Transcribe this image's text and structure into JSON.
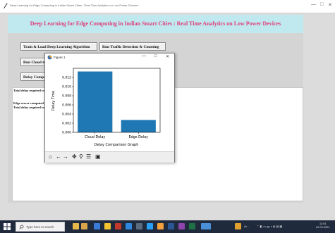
{
  "window": {
    "title": "Deep Learning for Edge Computing in Indian Smart Cities : Real Time Analytics on Low Power Devices",
    "controls": [
      "—",
      "□",
      "✕"
    ]
  },
  "header": {
    "title": "Deep Learning for Edge Computing in Indian Smart Cities : Real Time Analytics on Low Power Devices",
    "title_color": "#e0407a",
    "background": "#bfe8ef"
  },
  "buttons": {
    "train": "Train & Load Deep Learning Algorithm",
    "traffic": "Run Traffic Detection & Counting",
    "cloud": "Run Cloud to E",
    "delay": "Delay Compar"
  },
  "output": {
    "line1": "Total delay required to",
    "line2": "Edge server computed",
    "line3": "Total delay required to"
  },
  "figure": {
    "title": "Figure 1",
    "controls": [
      "—",
      "□",
      "✕"
    ],
    "toolbar": [
      "home-icon",
      "back-icon",
      "forward-icon",
      "pan-icon",
      "zoom-icon",
      "configure-icon",
      "save-icon"
    ]
  },
  "chart_data": {
    "type": "bar",
    "categories": [
      "Cloud Delay",
      "Edge Delay"
    ],
    "values": [
      0.0133,
      0.0027
    ],
    "xlabel": "Delay Comparison Graph",
    "ylabel": "Delay Time",
    "ylim": [
      0,
      0.014
    ],
    "yticks": [
      "0.000",
      "0.002",
      "0.004",
      "0.006",
      "0.008",
      "0.010",
      "0.012"
    ],
    "bar_color": "#1f77b4",
    "grid": false
  },
  "taskbar": {
    "search_placeholder": "Type here to search",
    "tray_text": "Ar...",
    "time": "12:01",
    "date": "22-02-2021"
  }
}
